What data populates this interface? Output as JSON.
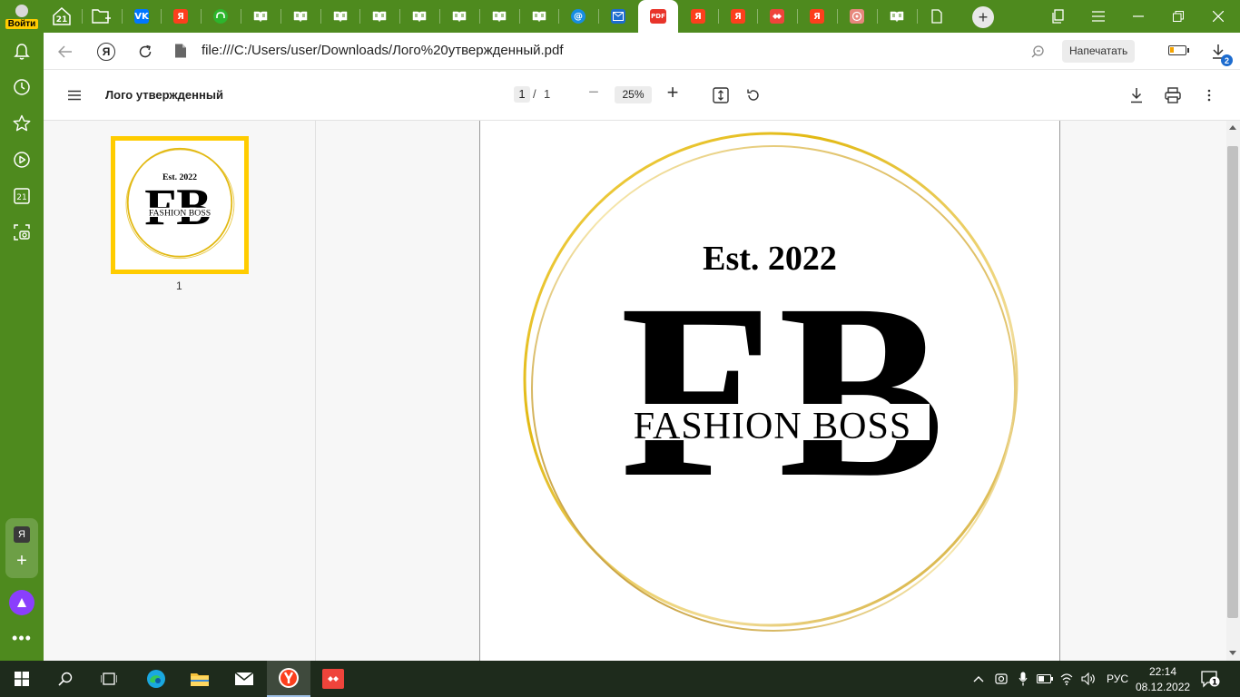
{
  "browser": {
    "login_label": "Войти",
    "tabs": [
      {
        "icon": "yandex-home-icon",
        "label": "21"
      },
      {
        "icon": "new-folder-icon",
        "label": ""
      },
      {
        "icon": "vk-icon",
        "label": "VK",
        "color": "#0077ff"
      },
      {
        "icon": "yandex-icon",
        "label": "Я",
        "color": "#fc3f1d"
      },
      {
        "icon": "headphones-icon",
        "label": "",
        "color": "#2db52d"
      },
      {
        "icon": "book-icon",
        "label": ""
      },
      {
        "icon": "book-icon",
        "label": ""
      },
      {
        "icon": "book-icon",
        "label": ""
      },
      {
        "icon": "book-icon",
        "label": ""
      },
      {
        "icon": "book-icon",
        "label": ""
      },
      {
        "icon": "book-icon",
        "label": ""
      },
      {
        "icon": "book-icon",
        "label": ""
      },
      {
        "icon": "book-icon",
        "label": ""
      },
      {
        "icon": "mail-at-icon",
        "label": "@",
        "color": "#168de2"
      },
      {
        "icon": "mail-envelope-icon",
        "label": "",
        "color": "#1d6ccf"
      },
      {
        "icon": "pdf-icon",
        "label": "PDF",
        "color": "#e8342a",
        "active": true
      },
      {
        "icon": "yandex-icon",
        "label": "Я",
        "color": "#fc3f1d"
      },
      {
        "icon": "yandex-icon",
        "label": "Я",
        "color": "#fc3f1d"
      },
      {
        "icon": "anydesk-icon",
        "label": "",
        "color": "#ef443b"
      },
      {
        "icon": "yandex-icon",
        "label": "Я",
        "color": "#fc3f1d"
      },
      {
        "icon": "image-icon",
        "label": "",
        "color": "#e7877c"
      },
      {
        "icon": "book-icon",
        "label": ""
      },
      {
        "icon": "blank-page-icon",
        "label": ""
      }
    ],
    "url": "file:///C:/Users/user/Downloads/Лого%20утвержденный.pdf",
    "print_label": "Напечатать",
    "downloads_count": "2",
    "battery_level": 0.25
  },
  "sidebar": {
    "ya_label": "Я",
    "calendar_label": "21"
  },
  "pdf": {
    "title": "Лого утвержденный",
    "page_current": "1",
    "page_separator": "/",
    "page_total": "1",
    "zoom": "25%",
    "thumbnail_number": "1",
    "logo": {
      "established": "Est. 2022",
      "monogram_left": "F",
      "monogram_right": "B",
      "brand": "FASHION BOSS",
      "ring_color": "#e2b913"
    }
  },
  "taskbar": {
    "language": "РУС",
    "time": "22:14",
    "date": "08.12.2022",
    "notifications": "1"
  }
}
